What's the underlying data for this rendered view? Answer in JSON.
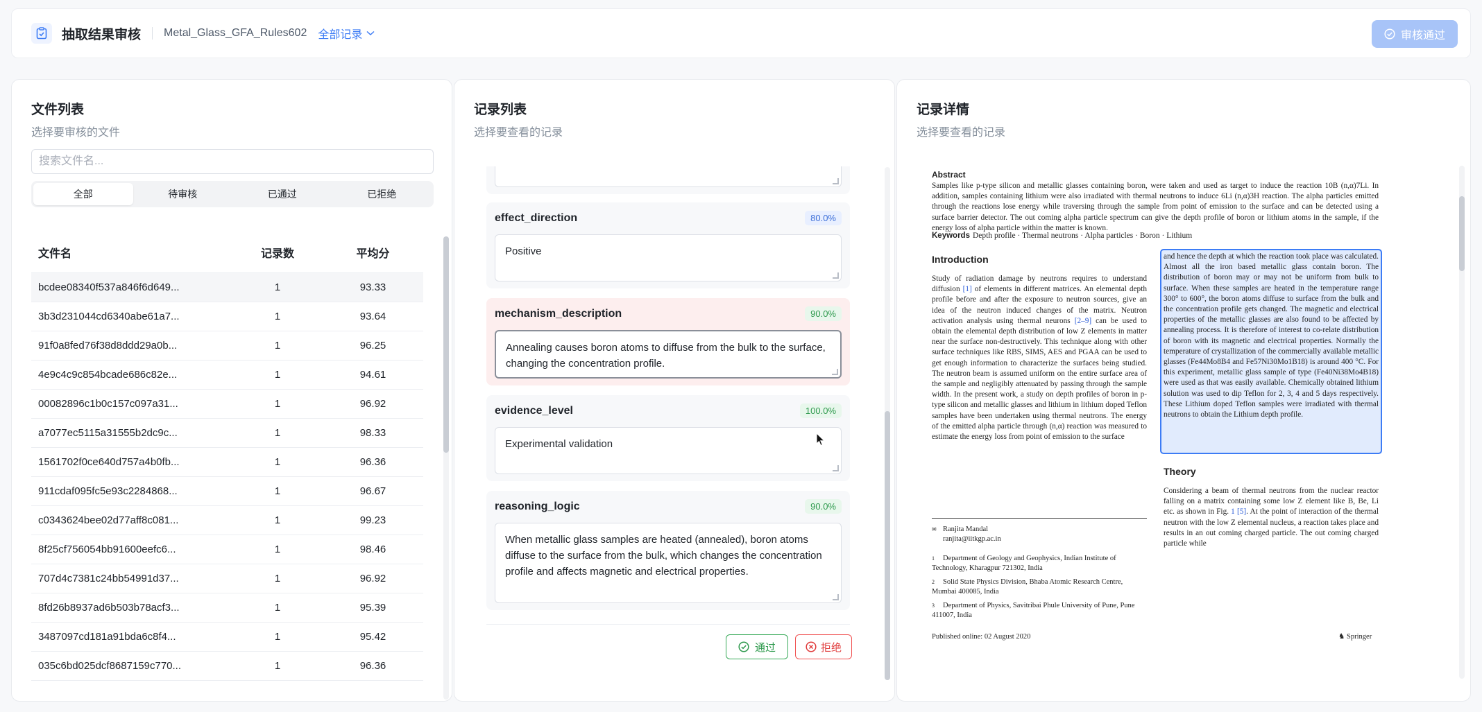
{
  "header": {
    "title": "抽取结果审核",
    "project": "Metal_Glass_GFA_Rules602",
    "filter": "全部记录",
    "approve_button": "审核通过"
  },
  "files_panel": {
    "title": "文件列表",
    "subtitle": "选择要审核的文件",
    "search_placeholder": "搜索文件名...",
    "tabs": [
      "全部",
      "待审核",
      "已通过",
      "已拒绝"
    ],
    "columns": [
      "文件名",
      "记录数",
      "平均分"
    ],
    "rows": [
      [
        "bcdee08340f537a846f6d649...",
        "1",
        "93.33"
      ],
      [
        "3b3d231044cd6340abe61a7...",
        "1",
        "93.64"
      ],
      [
        "91f0a8fed76f38d8ddd29a0b...",
        "1",
        "96.25"
      ],
      [
        "4e9c4c9c854bcade686c82e...",
        "1",
        "94.61"
      ],
      [
        "00082896c1b0c157c097a31...",
        "1",
        "96.92"
      ],
      [
        "a7077ec5115a31555b2dc9c...",
        "1",
        "98.33"
      ],
      [
        "1561702f0ce640d757a4b0fb...",
        "1",
        "96.36"
      ],
      [
        "911cdaf095fc5e93c2284868...",
        "1",
        "96.67"
      ],
      [
        "c0343624bee02d77aff8c081...",
        "1",
        "99.23"
      ],
      [
        "8f25cf756054bb91600eefc6...",
        "1",
        "98.46"
      ],
      [
        "707d4c7381c24bb54991d37...",
        "1",
        "96.92"
      ],
      [
        "8fd26b8937ad6b503b78acf3...",
        "1",
        "95.39"
      ],
      [
        "3487097cd181a91bda6c8f4...",
        "1",
        "95.42"
      ],
      [
        "035c6bd025dcf8687159c770...",
        "1",
        "96.36"
      ]
    ]
  },
  "records_panel": {
    "title": "记录列表",
    "subtitle": "选择要查看的记录",
    "fields": [
      {
        "name": "effect_direction",
        "score": "80.0%",
        "value": "Positive"
      },
      {
        "name": "mechanism_description",
        "score": "90.0%",
        "value": "Annealing causes boron atoms to diffuse from the bulk to the surface, changing the concentration profile."
      },
      {
        "name": "evidence_level",
        "score": "100.0%",
        "value": "Experimental validation"
      },
      {
        "name": "reasoning_logic",
        "score": "90.0%",
        "value": "When metallic glass samples are heated (annealed), boron atoms diffuse to the surface from the bulk, which changes the concentration profile and affects magnetic and electrical properties."
      }
    ],
    "pass_button": "通过",
    "reject_button": "拒绝"
  },
  "detail_panel": {
    "title": "记录详情",
    "subtitle": "选择要查看的记录",
    "doc": {
      "abstract_heading": "Abstract",
      "abstract": "Samples like p-type silicon and metallic glasses containing boron, were taken and used as target to induce the reaction 10B (n,α)7Li. In addition, samples containing lithium were also irradiated with thermal neutrons to induce 6Li (n,α)3H reaction. The alpha particles emitted through the reactions lose energy while traversing through the sample from point of emission to the surface and can be detected using a surface barrier detector. The out coming alpha particle spectrum can give the depth profile of boron or lithium atoms in the sample, if the energy loss of alpha particle within the matter is known.",
      "keywords_label": "Keywords",
      "keywords": "Depth profile · Thermal neutrons · Alpha particles · Boron · Lithium",
      "intro_heading": "Introduction",
      "intro_a": "Study of radiation damage by neutrons requires to understand diffusion ",
      "ref1": "[1]",
      "intro_b": " of elements in different matrices. An elemental depth profile before and after the exposure to neutron sources, give an idea of the neutron induced changes of the matrix. Neutron activation analysis using thermal neurons ",
      "ref2": "[2–9]",
      "intro_c": " can be used to obtain the elemental depth distribution of low Z elements in matter near the surface non-destructively. This technique along with other surface techniques like RBS, SIMS, AES and PGAA can be used to get enough information to characterize the surfaces being studied. The neutron beam is assumed uniform on the entire surface area of the sample and negligibly attenuated by passing through the sample width. In the present work, a study on depth profiles of boron in p-type silicon and metallic glasses and lithium in lithium doped Teflon samples have been undertaken using thermal neutrons. The energy of the emitted alpha particle through (n,α) reaction was measured to estimate the energy loss from point of emission to the surface",
      "highlight": "and hence the depth at which the reaction took place was calculated. Almost all the iron based metallic glass contain boron. The distribution of boron may or may not be uniform from bulk to surface. When these samples are heated in the temperature range 300° to 600°, the boron atoms diffuse to surface from the bulk and the concentration profile gets changed. The magnetic and electrical properties of the metallic glasses are also found to be affected by annealing process. It is therefore of interest to co-relate distribution of boron with its magnetic and electrical properties. Normally the temperature of crystallization of the commercially available metallic glasses (Fe44Mo8B4 and Fe57Ni30Mo1B18) is around 400 °C. For this experiment, metallic glass sample of type (Fe40Ni38Mo4B18) were used as that was easily available. Chemically obtained lithium solution was used to dip Teflon for 2, 3, 4 and 5 days respectively. These Lithium doped Teflon samples were irradiated with thermal neutrons to obtain the Lithium depth profile.",
      "theory_heading": "Theory",
      "theory_a": "Considering a beam of thermal neutrons from the nuclear reactor falling on a matrix containing some low Z element like B, Be, Li etc. as shown in Fig. ",
      "fig_ref": "1",
      "ref5": "[5]",
      "theory_b": ". At the point of interaction of the thermal neutron with the low Z elemental nucleus, a reaction takes place and results in an out coming charged particle. The out coming charged particle while",
      "author": "Ranjita Mandal",
      "email": "ranjita@iitkgp.ac.in",
      "aff1": "Department of Geology and Geophysics, Indian Institute of Technology, Kharagpur 721302, India",
      "aff2": "Solid State Physics Division, Bhaba Atomic Research Centre, Mumbai 400085, India",
      "aff3": "Department of Physics, Savitribai Phule University of Pune, Pune 411007, India",
      "published": "Published online: 02 August 2020",
      "publisher": "Springer"
    }
  },
  "colors": {
    "accent": "#3d7cf5",
    "pass": "#2f9a4e",
    "reject": "#e03c3c"
  }
}
